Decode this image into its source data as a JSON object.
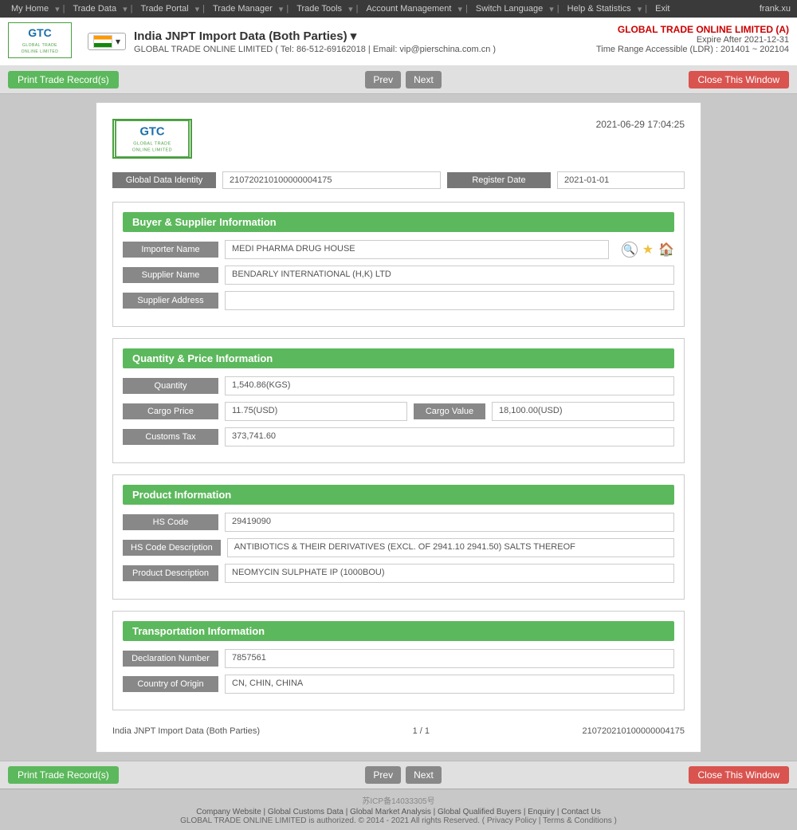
{
  "topnav": {
    "items": [
      {
        "label": "My Home",
        "id": "my-home"
      },
      {
        "label": "Trade Data",
        "id": "trade-data"
      },
      {
        "label": "Trade Portal",
        "id": "trade-portal"
      },
      {
        "label": "Trade Manager",
        "id": "trade-manager"
      },
      {
        "label": "Trade Tools",
        "id": "trade-tools"
      },
      {
        "label": "Account Management",
        "id": "account-management"
      },
      {
        "label": "Switch Language",
        "id": "switch-language"
      },
      {
        "label": "Help & Statistics",
        "id": "help-statistics"
      },
      {
        "label": "Exit",
        "id": "exit"
      }
    ],
    "username": "frank.xu"
  },
  "header": {
    "title": "India JNPT Import Data (Both Parties) ▾",
    "subtitle": "GLOBAL TRADE ONLINE LIMITED ( Tel: 86-512-69162018 | Email: vip@pierschina.com.cn )",
    "account_company": "GLOBAL TRADE ONLINE LIMITED (A)",
    "account_expire": "Expire After 2021-12-31",
    "account_range": "Time Range Accessible (LDR) : 201401 ~ 202104"
  },
  "toolbar": {
    "print_label": "Print Trade Record(s)",
    "prev_label": "Prev",
    "next_label": "Next",
    "close_label": "Close This Window"
  },
  "record": {
    "datetime": "2021-06-29 17:04:25",
    "global_data_identity_label": "Global Data Identity",
    "global_data_identity_value": "210720210100000004175",
    "register_date_label": "Register Date",
    "register_date_value": "2021-01-01",
    "sections": {
      "buyer_supplier": {
        "title": "Buyer & Supplier Information",
        "fields": [
          {
            "label": "Importer Name",
            "value": "MEDI PHARMA DRUG HOUSE"
          },
          {
            "label": "Supplier Name",
            "value": "BENDARLY INTERNATIONAL  (H,K) LTD"
          },
          {
            "label": "Supplier Address",
            "value": ""
          }
        ]
      },
      "quantity_price": {
        "title": "Quantity & Price Information",
        "quantity_label": "Quantity",
        "quantity_value": "1,540.86(KGS)",
        "cargo_price_label": "Cargo Price",
        "cargo_price_value": "11.75(USD)",
        "cargo_value_label": "Cargo Value",
        "cargo_value_value": "18,100.00(USD)",
        "customs_tax_label": "Customs Tax",
        "customs_tax_value": "373,741.60"
      },
      "product": {
        "title": "Product Information",
        "fields": [
          {
            "label": "HS Code",
            "value": "29419090"
          },
          {
            "label": "HS Code Description",
            "value": "ANTIBIOTICS & THEIR DERIVATIVES (EXCL. OF 2941.10 2941.50) SALTS THEREOF"
          },
          {
            "label": "Product Description",
            "value": "NEOMYCIN SULPHATE IP (1000BOU)"
          }
        ]
      },
      "transportation": {
        "title": "Transportation Information",
        "fields": [
          {
            "label": "Declaration Number",
            "value": "7857561"
          },
          {
            "label": "Country of Origin",
            "value": "CN, CHIN, CHINA"
          }
        ]
      }
    },
    "footer": {
      "record_type": "India JNPT Import Data (Both Parties)",
      "page_info": "1 / 1",
      "record_id": "210720210100000004175"
    }
  },
  "footer": {
    "icp": "苏ICP备14033305号",
    "links": [
      "Company Website",
      "Global Customs Data",
      "Global Market Analysis",
      "Global Qualified Buyers",
      "Enquiry",
      "Contact Us"
    ],
    "copyright": "GLOBAL TRADE ONLINE LIMITED is authorized. © 2014 - 2021 All rights Reserved. ( Privacy Policy | Terms & Conditions )"
  }
}
